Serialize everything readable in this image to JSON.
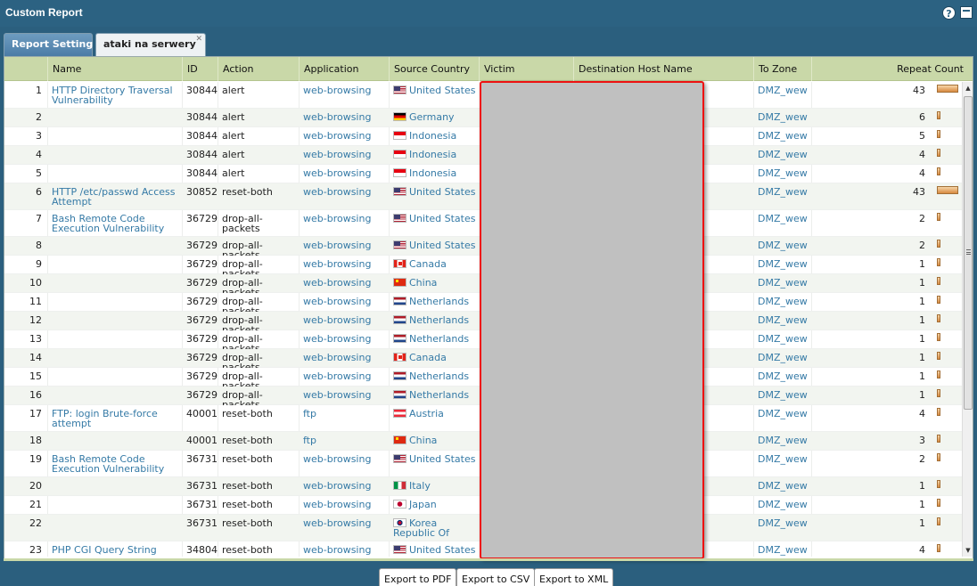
{
  "window": {
    "title": "Custom Report"
  },
  "tabs": [
    {
      "label": "Report Setting"
    },
    {
      "label": "ataki na serwery"
    }
  ],
  "columns": [
    "Name",
    "ID",
    "Action",
    "Application",
    "Source Country",
    "Victim",
    "Destination Host Name",
    "To Zone",
    "Repeat Count"
  ],
  "rows": [
    {
      "num": "1",
      "name": "HTTP Directory Traversal Vulnerability",
      "id": "30844",
      "action": "alert",
      "app": "web-browsing",
      "flag": "us",
      "country": "United States",
      "zone": "DMZ_wew",
      "count": "43"
    },
    {
      "num": "2",
      "name": "",
      "id": "30844",
      "action": "alert",
      "app": "web-browsing",
      "flag": "de",
      "country": "Germany",
      "zone": "DMZ_wew",
      "count": "6"
    },
    {
      "num": "3",
      "name": "",
      "id": "30844",
      "action": "alert",
      "app": "web-browsing",
      "flag": "id",
      "country": "Indonesia",
      "zone": "DMZ_wew",
      "count": "5"
    },
    {
      "num": "4",
      "name": "",
      "id": "30844",
      "action": "alert",
      "app": "web-browsing",
      "flag": "id",
      "country": "Indonesia",
      "zone": "DMZ_wew",
      "count": "4"
    },
    {
      "num": "5",
      "name": "",
      "id": "30844",
      "action": "alert",
      "app": "web-browsing",
      "flag": "id",
      "country": "Indonesia",
      "zone": "DMZ_wew",
      "count": "4"
    },
    {
      "num": "6",
      "name": "HTTP /etc/passwd Access Attempt",
      "id": "30852",
      "action": "reset-both",
      "app": "web-browsing",
      "flag": "us",
      "country": "United States",
      "zone": "DMZ_wew",
      "count": "43"
    },
    {
      "num": "7",
      "name": "Bash Remote Code Execution Vulnerability",
      "id": "36729",
      "action": "drop-all-packets",
      "app": "web-browsing",
      "flag": "us",
      "country": "United States",
      "zone": "DMZ_wew",
      "count": "2"
    },
    {
      "num": "8",
      "name": "",
      "id": "36729",
      "action": "drop-all-packets",
      "app": "web-browsing",
      "flag": "us",
      "country": "United States",
      "zone": "DMZ_wew",
      "count": "2"
    },
    {
      "num": "9",
      "name": "",
      "id": "36729",
      "action": "drop-all-packets",
      "app": "web-browsing",
      "flag": "ca",
      "country": "Canada",
      "zone": "DMZ_wew",
      "count": "1"
    },
    {
      "num": "10",
      "name": "",
      "id": "36729",
      "action": "drop-all-packets",
      "app": "web-browsing",
      "flag": "cn",
      "country": "China",
      "zone": "DMZ_wew",
      "count": "1"
    },
    {
      "num": "11",
      "name": "",
      "id": "36729",
      "action": "drop-all-packets",
      "app": "web-browsing",
      "flag": "nl",
      "country": "Netherlands",
      "zone": "DMZ_wew",
      "count": "1"
    },
    {
      "num": "12",
      "name": "",
      "id": "36729",
      "action": "drop-all-packets",
      "app": "web-browsing",
      "flag": "nl",
      "country": "Netherlands",
      "zone": "DMZ_wew",
      "count": "1"
    },
    {
      "num": "13",
      "name": "",
      "id": "36729",
      "action": "drop-all-packets",
      "app": "web-browsing",
      "flag": "nl",
      "country": "Netherlands",
      "zone": "DMZ_wew",
      "count": "1"
    },
    {
      "num": "14",
      "name": "",
      "id": "36729",
      "action": "drop-all-packets",
      "app": "web-browsing",
      "flag": "ca",
      "country": "Canada",
      "zone": "DMZ_wew",
      "count": "1"
    },
    {
      "num": "15",
      "name": "",
      "id": "36729",
      "action": "drop-all-packets",
      "app": "web-browsing",
      "flag": "nl",
      "country": "Netherlands",
      "zone": "DMZ_wew",
      "count": "1"
    },
    {
      "num": "16",
      "name": "",
      "id": "36729",
      "action": "drop-all-packets",
      "app": "web-browsing",
      "flag": "nl",
      "country": "Netherlands",
      "zone": "DMZ_wew",
      "count": "1"
    },
    {
      "num": "17",
      "name": "FTP: login Brute-force attempt",
      "id": "40001",
      "action": "reset-both",
      "app": "ftp",
      "flag": "at",
      "country": "Austria",
      "zone": "DMZ_wew",
      "count": "4"
    },
    {
      "num": "18",
      "name": "",
      "id": "40001",
      "action": "reset-both",
      "app": "ftp",
      "flag": "cn",
      "country": "China",
      "zone": "DMZ_wew",
      "count": "3"
    },
    {
      "num": "19",
      "name": "Bash Remote Code Execution Vulnerability",
      "id": "36731",
      "action": "reset-both",
      "app": "web-browsing",
      "flag": "us",
      "country": "United States",
      "zone": "DMZ_wew",
      "count": "2"
    },
    {
      "num": "20",
      "name": "",
      "id": "36731",
      "action": "reset-both",
      "app": "web-browsing",
      "flag": "it",
      "country": "Italy",
      "zone": "DMZ_wew",
      "count": "1"
    },
    {
      "num": "21",
      "name": "",
      "id": "36731",
      "action": "reset-both",
      "app": "web-browsing",
      "flag": "jp",
      "country": "Japan",
      "zone": "DMZ_wew",
      "count": "1"
    },
    {
      "num": "22",
      "name": "",
      "id": "36731",
      "action": "reset-both",
      "app": "web-browsing",
      "flag": "kr",
      "country": "Korea Republic Of",
      "zone": "DMZ_wew",
      "count": "1"
    },
    {
      "num": "23",
      "name": "PHP CGI Query String",
      "id": "34804",
      "action": "reset-both",
      "app": "web-browsing",
      "flag": "us",
      "country": "United States",
      "zone": "DMZ_wew",
      "count": "4"
    }
  ],
  "buttons": {
    "export_pdf": "Export to PDF",
    "export_csv": "Export to CSV",
    "export_xml": "Export to XML"
  }
}
